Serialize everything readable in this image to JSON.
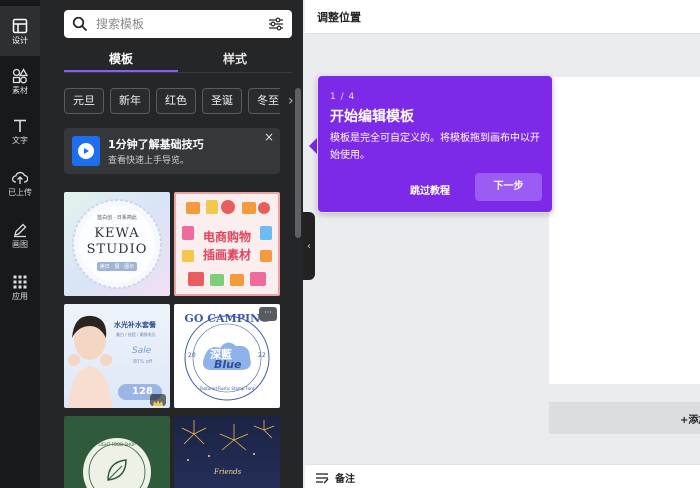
{
  "rail": [
    {
      "label": "设计",
      "icon": "layout-icon",
      "active": true
    },
    {
      "label": "素材",
      "icon": "elements-icon"
    },
    {
      "label": "文字",
      "icon": "text-icon"
    },
    {
      "label": "已上传",
      "icon": "cloud-upload-icon"
    },
    {
      "label": "画图",
      "icon": "draw-icon"
    },
    {
      "label": "应用",
      "icon": "apps-icon"
    }
  ],
  "panel": {
    "search_placeholder": "搜索模板",
    "tabs": [
      {
        "label": "模板",
        "active": true
      },
      {
        "label": "样式"
      }
    ],
    "chips": [
      "元旦",
      "新年",
      "红色",
      "圣诞",
      "冬至"
    ],
    "promo": {
      "title": "1分钟了解基础技巧",
      "subtitle": "查看快速上手导览。",
      "close": "×"
    },
    "thumbs": [
      {
        "kind": "kewa",
        "lines": [
          "蓝白创 · 日系简此",
          "KEWA",
          "STUDIO",
          "美日 · 展 · 图示"
        ]
      },
      {
        "kind": "shop",
        "lines": [
          "电商购物",
          "插画素材"
        ]
      },
      {
        "kind": "skincare",
        "lines": [
          "水光补水套餐",
          "美白 / 祛痘 / 嫩肤毛孔",
          "Sale",
          "80% off",
          "128"
        ]
      },
      {
        "kind": "camping",
        "lines": [
          "GO CAMPING",
          "深藍",
          "Blue",
          "20",
          "22",
          "Textured Rustic Stamp Font"
        ],
        "more": "···"
      },
      {
        "kind": "green",
        "lines": [
          "LIGHT FOOD SHOP"
        ]
      },
      {
        "kind": "fireworks",
        "lines": [
          "Friends"
        ]
      }
    ]
  },
  "topbar": {
    "title": "调整位置"
  },
  "canvas": {
    "add_page": "+添加页面"
  },
  "bottombar": {
    "notes": "备注"
  },
  "popover": {
    "step": "1 / 4",
    "title": "开始编辑模板",
    "body": "模板是完全可自定义的。将模板拖到画布中以开始使用。",
    "skip": "跳过教程",
    "next": "下一步"
  },
  "colors": {
    "accent": "#7d2ae8",
    "rail": "#18191b",
    "panel": "#252627"
  }
}
